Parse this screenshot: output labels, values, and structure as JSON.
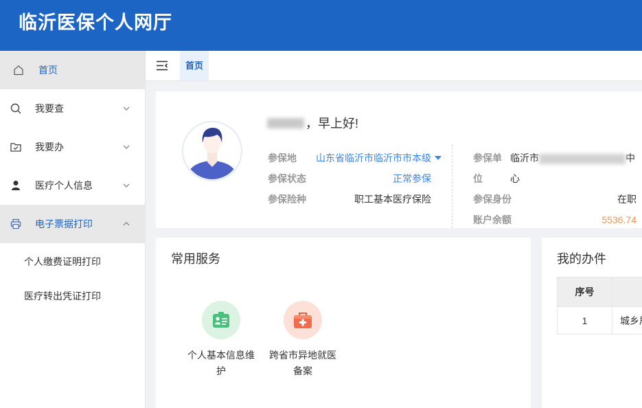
{
  "header": {
    "title": "临沂医保个人网厅"
  },
  "colors": {
    "primary": "#1d65c4",
    "link": "#3a86e8",
    "amount": "#e8955a",
    "label": "#999999",
    "active_bg": "#e8e8e8",
    "page_bg": "#f0f2f5"
  },
  "sidebar": {
    "items": [
      {
        "label": "首页",
        "icon": "home-icon",
        "active": true
      },
      {
        "label": "我要查",
        "icon": "search-icon",
        "expandable": true,
        "expanded": false
      },
      {
        "label": "我要办",
        "icon": "folder-check-icon",
        "expandable": true,
        "expanded": false
      },
      {
        "label": "医疗个人信息",
        "icon": "person-icon",
        "expandable": true,
        "expanded": false
      },
      {
        "label": "电子票据打印",
        "icon": "printer-icon",
        "expandable": true,
        "expanded": true
      }
    ],
    "submenu": [
      {
        "label": "个人缴费证明打印"
      },
      {
        "label": "医疗转出凭证打印"
      }
    ]
  },
  "tabbar": {
    "collapse_icon": "menu-fold-icon",
    "tabs": [
      {
        "label": "首页",
        "active": true
      }
    ]
  },
  "profile": {
    "avatar_icon": "user-avatar-icon",
    "greeting": "，早上好!",
    "left": [
      {
        "label": "参保地",
        "value": "山东省临沂市临沂市市本级",
        "dropdown": true
      },
      {
        "label": "参保状态",
        "value": "正常参保"
      },
      {
        "label": "参保险种",
        "value": "职工基本医疗保险"
      }
    ],
    "right": [
      {
        "label": "参保单位",
        "value_prefix": "临沂市",
        "value_suffix": "中心"
      },
      {
        "label": "参保身份",
        "value": "在职"
      },
      {
        "label": "账户余额",
        "value": "5536.74"
      }
    ]
  },
  "services": {
    "title": "常用服务",
    "items": [
      {
        "label": "个人基本信息维护",
        "icon": "id-card-icon",
        "color": "#49c07b"
      },
      {
        "label": "跨省市异地就医备案",
        "icon": "first-aid-kit-icon",
        "color": "#f26b4c"
      }
    ]
  },
  "tasks": {
    "title": "我的办件",
    "headers": [
      "序号"
    ],
    "rows": [
      {
        "index": "1",
        "name": "城乡居"
      }
    ]
  }
}
